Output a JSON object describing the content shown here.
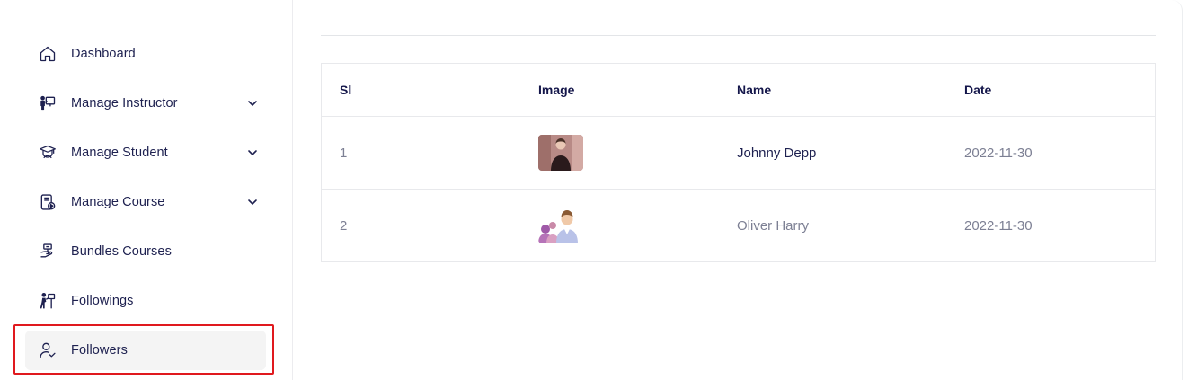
{
  "sidebar": {
    "items": [
      {
        "label": "Dashboard",
        "icon": "home-icon",
        "has_chevron": false
      },
      {
        "label": "Manage Instructor",
        "icon": "instructor-icon",
        "has_chevron": true
      },
      {
        "label": "Manage Student",
        "icon": "student-icon",
        "has_chevron": true
      },
      {
        "label": "Manage Course",
        "icon": "course-icon",
        "has_chevron": true
      },
      {
        "label": "Bundles Courses",
        "icon": "bundle-icon",
        "has_chevron": false
      },
      {
        "label": "Followings",
        "icon": "followings-icon",
        "has_chevron": false
      },
      {
        "label": "Followers",
        "icon": "followers-icon",
        "has_chevron": false,
        "active": true
      }
    ]
  },
  "table": {
    "columns": [
      "Sl",
      "Image",
      "Name",
      "Date"
    ],
    "rows": [
      {
        "sl": "1",
        "image": "avatar-johnny-depp",
        "name": "Johnny Depp",
        "date": "2022-11-30"
      },
      {
        "sl": "2",
        "image": "avatar-oliver-harry",
        "name": "Oliver Harry",
        "date": "2022-11-30"
      }
    ]
  },
  "colors": {
    "text_primary": "#1e2150",
    "text_muted": "#7d8094",
    "active_bg": "#f4f4f4",
    "highlight_border": "#e0191e"
  }
}
